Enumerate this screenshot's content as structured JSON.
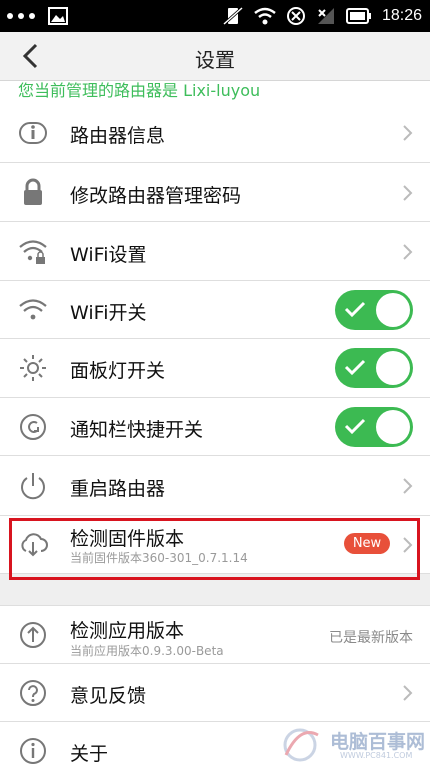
{
  "statusbar": {
    "time": "18:26"
  },
  "header": {
    "title": "设置"
  },
  "banner": {
    "text": "您当前管理的路由器是 Lixi-luyou"
  },
  "items": [
    {
      "label": "路由器信息"
    },
    {
      "label": "修改路由器管理密码"
    },
    {
      "label": "WiFi设置"
    },
    {
      "label": "WiFi开关",
      "toggle_on": true
    },
    {
      "label": "面板灯开关",
      "toggle_on": true
    },
    {
      "label": "通知栏快捷开关",
      "toggle_on": true
    },
    {
      "label": "重启路由器"
    },
    {
      "label": "检测固件版本",
      "subtitle": "当前固件版本360-301_0.7.1.14",
      "badge": "New"
    },
    {
      "label": "检测应用版本",
      "subtitle": "当前应用版本0.9.3.00-Beta",
      "status": "已是最新版本"
    },
    {
      "label": "意见反馈"
    },
    {
      "label": "关于"
    }
  ],
  "watermark": {
    "text": "电脑百事网",
    "url": "WWW.PC841.COM"
  },
  "colors": {
    "accent_green": "#3cba52",
    "badge_red": "#e8503a",
    "highlight_red": "#d8141f",
    "banner_green": "#3ebd5b"
  }
}
